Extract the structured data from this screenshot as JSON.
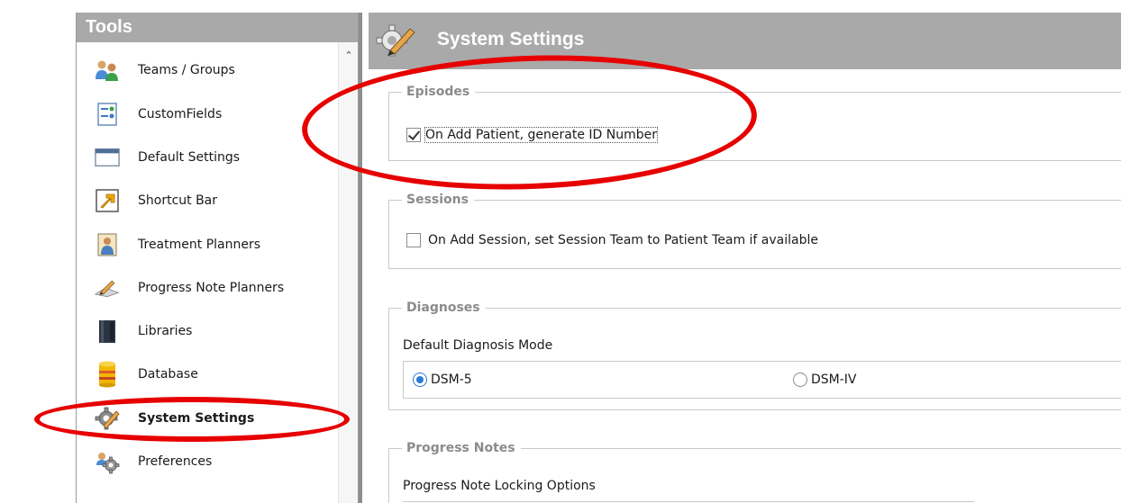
{
  "tools_panel": {
    "title": "Tools",
    "items": [
      {
        "label": "Teams / Groups",
        "icon": "team-icon"
      },
      {
        "label": "CustomFields",
        "icon": "custom-fields-icon"
      },
      {
        "label": "Default Settings",
        "icon": "window-icon"
      },
      {
        "label": "Shortcut Bar",
        "icon": "shortcut-arrow-icon"
      },
      {
        "label": "Treatment Planners",
        "icon": "person-icon"
      },
      {
        "label": "Progress Note Planners",
        "icon": "pen-note-icon"
      },
      {
        "label": "Libraries",
        "icon": "book-icon"
      },
      {
        "label": "Database",
        "icon": "database-icon"
      },
      {
        "label": "System Settings",
        "icon": "gear-icon",
        "selected": true
      },
      {
        "label": "Preferences",
        "icon": "gears-icon"
      }
    ],
    "scroll_up_icon": "chevron-up-icon"
  },
  "main": {
    "title": "System Settings",
    "title_icon": "gear-pencil-icon",
    "episodes": {
      "title": "Episodes",
      "option_label": "On Add Patient, generate ID Number",
      "checked": true
    },
    "sessions": {
      "title": "Sessions",
      "option_label": "On Add Session, set Session Team to Patient Team if available",
      "checked": false
    },
    "diagnoses": {
      "title": "Diagnoses",
      "mode_label": "Default Diagnosis Mode",
      "options": [
        "DSM-5",
        "DSM-IV"
      ],
      "selected": "DSM-5"
    },
    "progress_notes": {
      "title": "Progress Notes",
      "locking_label": "Progress Note Locking Options"
    }
  },
  "colors": {
    "header_gray": "#a9a9a9",
    "annotation_red": "#e60000",
    "radio_blue": "#2a7bd5",
    "group_title_gray": "#8b8b8b"
  }
}
